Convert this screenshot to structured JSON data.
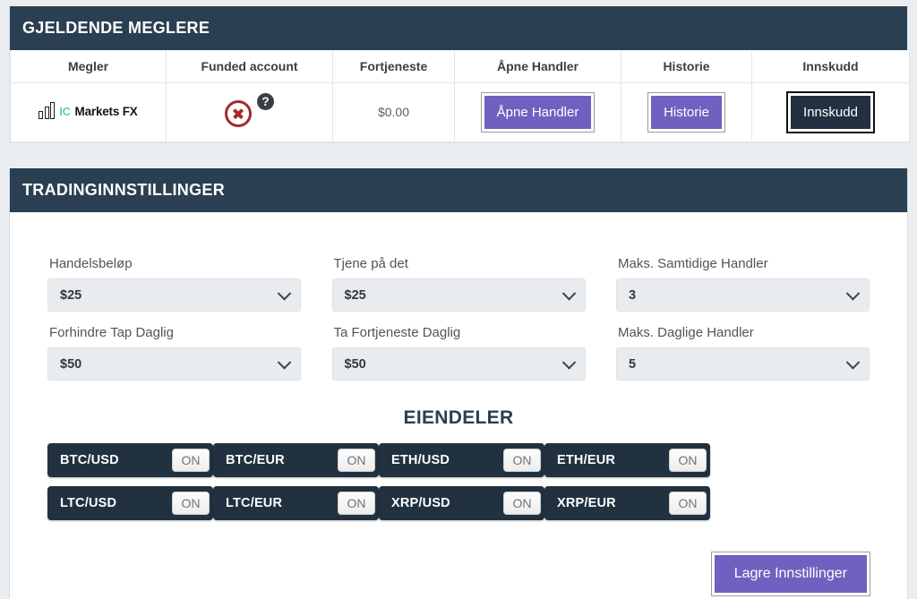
{
  "brokers": {
    "header_title": "GJELDENDE MEGLERE",
    "columns": [
      "Megler",
      "Funded account",
      "Fortjeneste",
      "Åpne Handler",
      "Historie",
      "Innskudd"
    ],
    "row": {
      "broker_logo_ic": "IC",
      "broker_logo_name": "Markets FX",
      "funded_status_icon": "error-circle-x-icon",
      "funded_help_icon": "?",
      "profit": "$0.00",
      "open_trades_button": "Åpne Handler",
      "history_button": "Historie",
      "deposit_button": "Innskudd"
    }
  },
  "settings": {
    "header_title": "TRADINGINNSTILLINGER",
    "fields": [
      {
        "label": "Handelsbeløp",
        "value": "$25"
      },
      {
        "label": "Tjene på det",
        "value": "$25"
      },
      {
        "label": "Maks. Samtidige Handler",
        "value": "3"
      },
      {
        "label": "Forhindre Tap Daglig",
        "value": "$50"
      },
      {
        "label": "Ta Fortjeneste Daglig",
        "value": "$50"
      },
      {
        "label": "Maks. Daglige Handler",
        "value": "5"
      }
    ],
    "assets_title": "EIENDELER",
    "assets": [
      {
        "pair": "BTC/USD",
        "state": "ON"
      },
      {
        "pair": "BTC/EUR",
        "state": "ON"
      },
      {
        "pair": "ETH/USD",
        "state": "ON"
      },
      {
        "pair": "ETH/EUR",
        "state": "ON"
      },
      {
        "pair": "LTC/USD",
        "state": "ON"
      },
      {
        "pair": "LTC/EUR",
        "state": "ON"
      },
      {
        "pair": "XRP/USD",
        "state": "ON"
      },
      {
        "pair": "XRP/EUR",
        "state": "ON"
      }
    ],
    "save_button": "Lagre Innstillinger"
  },
  "colors": {
    "header_navy": "#2a3f51",
    "accent_purple": "#7060c0",
    "dark_button": "#22313f",
    "page_bg": "#eaeef1",
    "error_red": "#a52a2a",
    "logo_green": "#5ed39a"
  }
}
